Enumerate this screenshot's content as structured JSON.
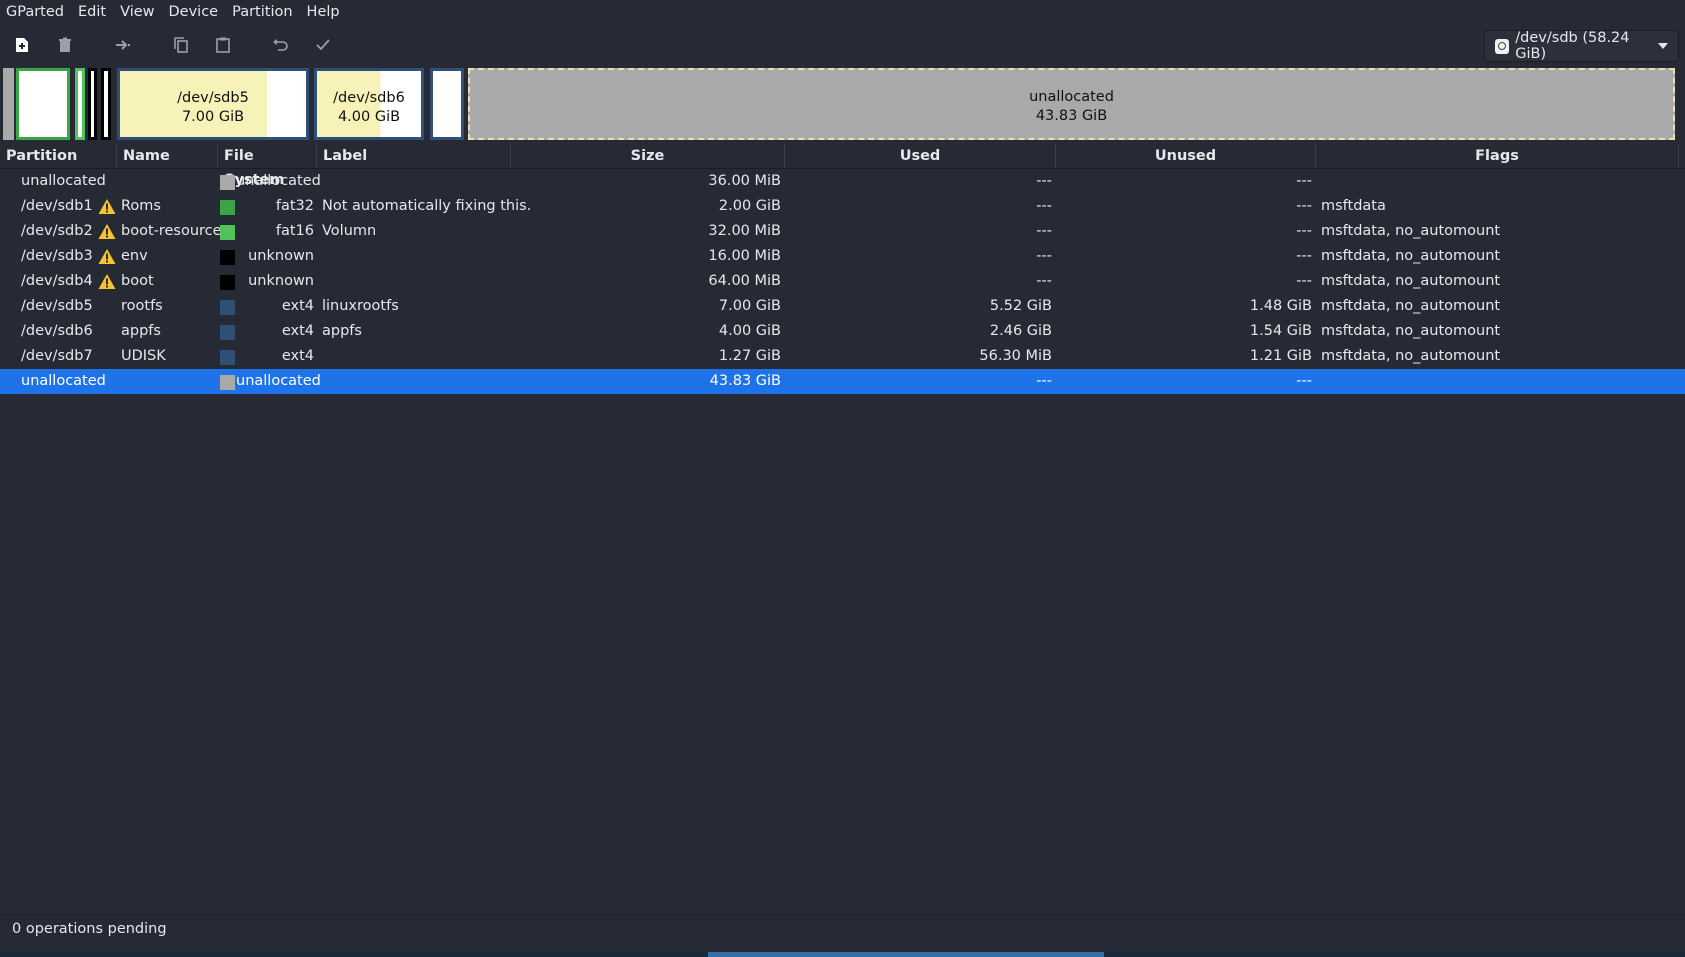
{
  "menu": [
    "GParted",
    "Edit",
    "View",
    "Device",
    "Partition",
    "Help"
  ],
  "toolbar": {
    "icons": [
      "new-partition-icon",
      "delete-icon",
      "resize-move-icon",
      "copy-icon",
      "paste-icon",
      "undo-icon",
      "apply-icon"
    ]
  },
  "device": {
    "label": "/dev/sdb (58.24 GiB)"
  },
  "diskmap": {
    "sdb5": {
      "name": "/dev/sdb5",
      "size": "7.00 GiB"
    },
    "sdb6": {
      "name": "/dev/sdb6",
      "size": "4.00 GiB"
    },
    "unallocated": {
      "name": "unallocated",
      "size": "43.83 GiB"
    }
  },
  "columns": [
    "Partition",
    "Name",
    "File System",
    "Label",
    "Size",
    "Used",
    "Unused",
    "Flags"
  ],
  "colors": {
    "fat32": "#3aa545",
    "fat16": "#4fc25c",
    "unknown": "#000000",
    "ext4": "#2f4f75",
    "unallocated": "#a9a9a9",
    "selection": "#1e73e8",
    "warning": "#f5c431"
  },
  "rows": [
    {
      "partition": "unallocated",
      "warning": false,
      "name": "",
      "fs": "unallocated",
      "fs_color": "#a9a9a9",
      "label": "",
      "size": "36.00 MiB",
      "used": "---",
      "unused": "---",
      "flags": ""
    },
    {
      "partition": "/dev/sdb1",
      "warning": true,
      "name": "Roms",
      "fs": "fat32",
      "fs_color": "#3aa545",
      "label": "Not automatically fixing this.",
      "size": "2.00 GiB",
      "used": "---",
      "unused": "---",
      "flags": "msftdata"
    },
    {
      "partition": "/dev/sdb2",
      "warning": true,
      "name": "boot-resource",
      "fs": "fat16",
      "fs_color": "#4fc25c",
      "label": "Volumn",
      "size": "32.00 MiB",
      "used": "---",
      "unused": "---",
      "flags": "msftdata, no_automount"
    },
    {
      "partition": "/dev/sdb3",
      "warning": true,
      "name": "env",
      "fs": "unknown",
      "fs_color": "#000000",
      "label": "",
      "size": "16.00 MiB",
      "used": "---",
      "unused": "---",
      "flags": "msftdata, no_automount"
    },
    {
      "partition": "/dev/sdb4",
      "warning": true,
      "name": "boot",
      "fs": "unknown",
      "fs_color": "#000000",
      "label": "",
      "size": "64.00 MiB",
      "used": "---",
      "unused": "---",
      "flags": "msftdata, no_automount"
    },
    {
      "partition": "/dev/sdb5",
      "warning": false,
      "name": "rootfs",
      "fs": "ext4",
      "fs_color": "#2f4f75",
      "label": "linuxrootfs",
      "size": "7.00 GiB",
      "used": "5.52 GiB",
      "unused": "1.48 GiB",
      "flags": "msftdata, no_automount"
    },
    {
      "partition": "/dev/sdb6",
      "warning": false,
      "name": "appfs",
      "fs": "ext4",
      "fs_color": "#2f4f75",
      "label": "appfs",
      "size": "4.00 GiB",
      "used": "2.46 GiB",
      "unused": "1.54 GiB",
      "flags": "msftdata, no_automount"
    },
    {
      "partition": "/dev/sdb7",
      "warning": false,
      "name": "UDISK",
      "fs": "ext4",
      "fs_color": "#2f4f75",
      "label": "",
      "size": "1.27 GiB",
      "used": "56.30 MiB",
      "unused": "1.21 GiB",
      "flags": "msftdata, no_automount"
    },
    {
      "partition": "unallocated",
      "warning": false,
      "name": "",
      "fs": "unallocated",
      "fs_color": "#a9a9a9",
      "label": "",
      "size": "43.83 GiB",
      "used": "---",
      "unused": "---",
      "flags": "",
      "selected": true
    }
  ],
  "status": {
    "text": "0 operations pending"
  }
}
